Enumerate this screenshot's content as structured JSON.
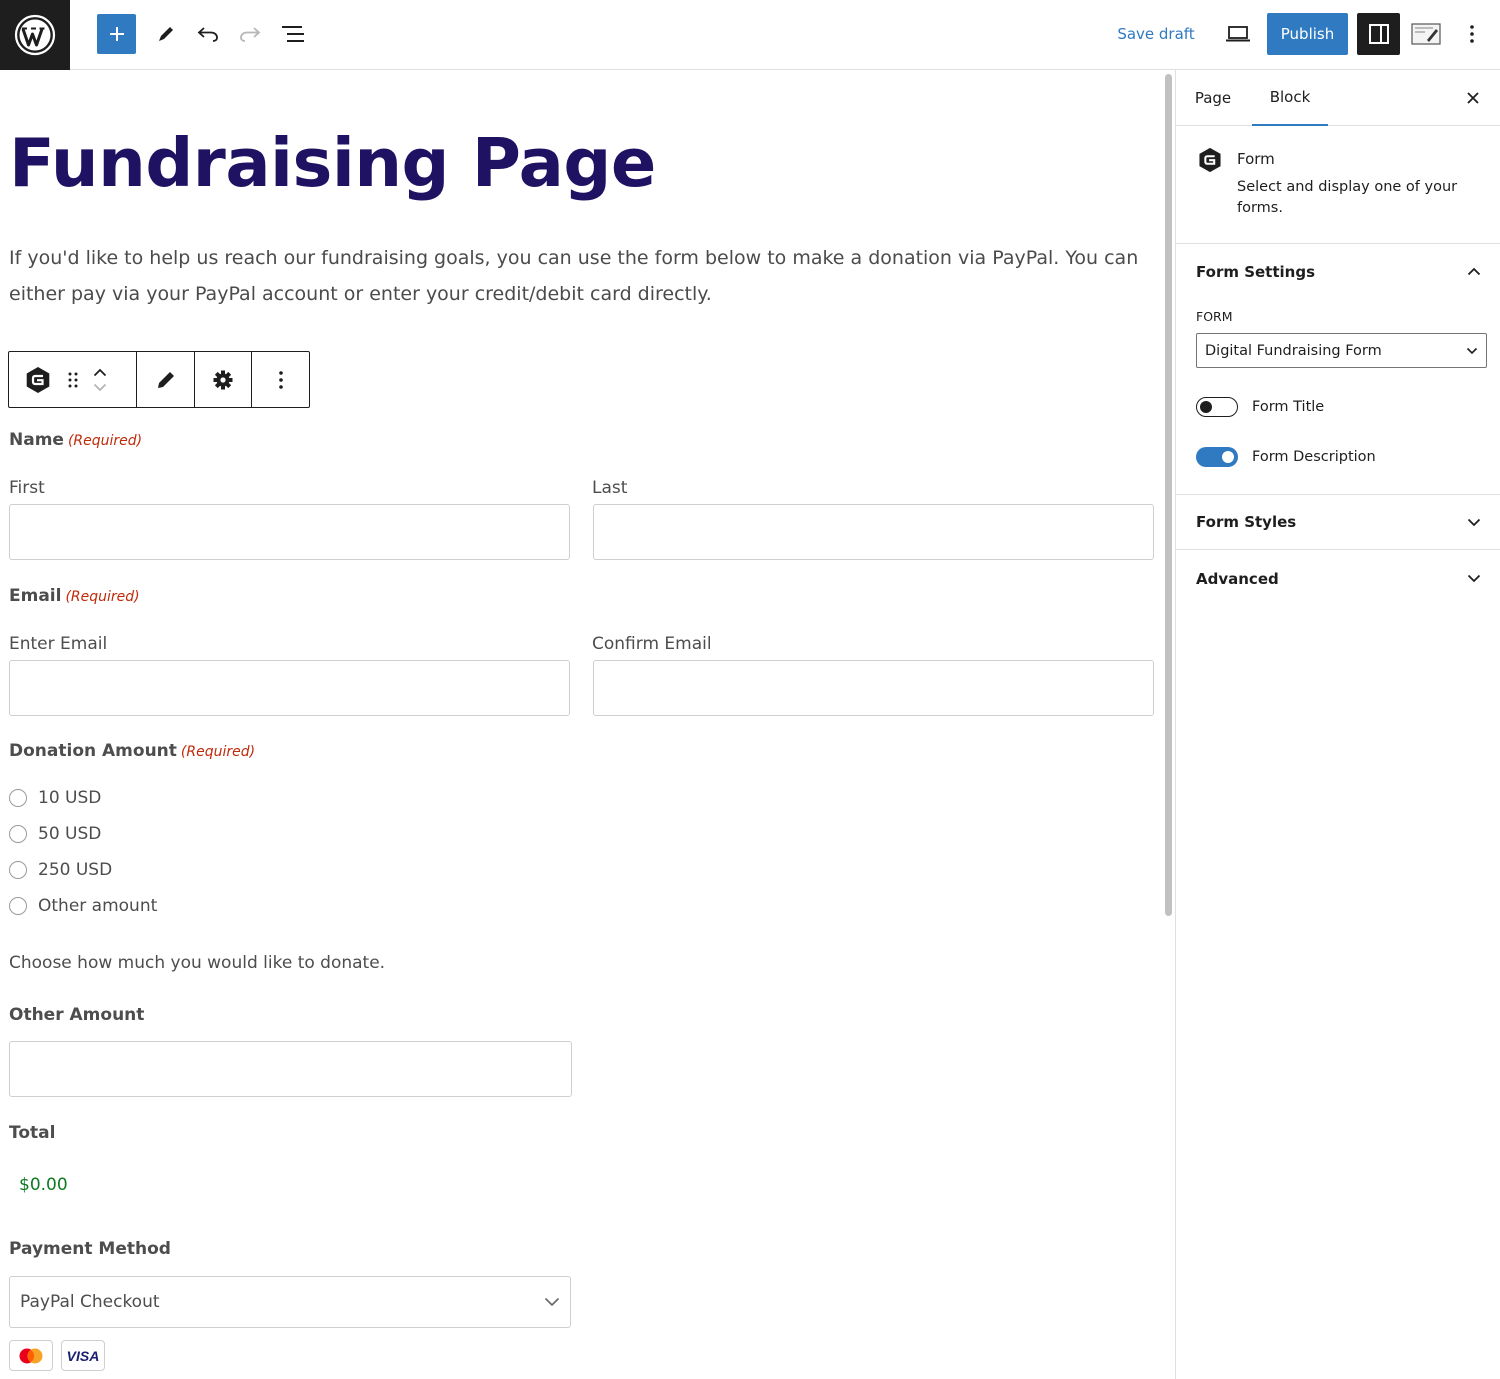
{
  "toolbar": {
    "save_draft": "Save draft",
    "publish": "Publish"
  },
  "page": {
    "title": "Fundraising Page",
    "intro": "If you'd like to help us reach our fundraising goals, you can use the form below to make a donation via PayPal. You can either pay via your PayPal account or enter your credit/debit card directly."
  },
  "form": {
    "name": {
      "label": "Name",
      "required": "(Required)",
      "first": "First",
      "last": "Last"
    },
    "email": {
      "label": "Email",
      "required": "(Required)",
      "enter": "Enter Email",
      "confirm": "Confirm Email"
    },
    "donation": {
      "label": "Donation Amount",
      "required": "(Required)",
      "options": [
        "10 USD",
        "50 USD",
        "250 USD",
        "Other amount"
      ],
      "description": "Choose how much you would like to donate."
    },
    "other_amount": {
      "label": "Other Amount"
    },
    "total": {
      "label": "Total",
      "value": "$0.00"
    },
    "payment": {
      "label": "Payment Method",
      "selected": "PayPal Checkout",
      "cards": [
        "mastercard",
        "VISA"
      ]
    }
  },
  "sidebar": {
    "tabs": [
      "Page",
      "Block"
    ],
    "active_tab": "Block",
    "block": {
      "title": "Form",
      "description": "Select and display one of your forms."
    },
    "form_settings": {
      "heading": "Form Settings",
      "form_caption": "FORM",
      "form_selected": "Digital Fundraising Form",
      "toggles": [
        {
          "label": "Form Title",
          "on": false
        },
        {
          "label": "Form Description",
          "on": true
        }
      ]
    },
    "panels": [
      "Form Styles",
      "Advanced"
    ]
  },
  "colors": {
    "accent": "#2f7ac0",
    "title": "#1f1263",
    "required": "#c02b0a",
    "total": "#0f7a23",
    "dark": "#1e1e1e"
  }
}
